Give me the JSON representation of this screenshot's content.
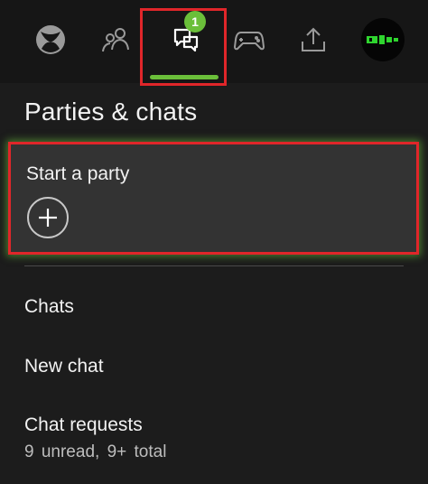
{
  "colors": {
    "accent": "#6bbf3a",
    "badge": "#6bbf3a",
    "highlight": "#e0262a",
    "icon": "#9a9a9a"
  },
  "nav": {
    "items": [
      {
        "icon": "xbox-logo-icon"
      },
      {
        "icon": "friends-icon"
      },
      {
        "icon": "parties-chats-icon",
        "active": true
      },
      {
        "icon": "controller-icon"
      },
      {
        "icon": "share-icon"
      },
      {
        "icon": "profile-avatar"
      }
    ],
    "parties_badge": "1"
  },
  "main": {
    "title": "Parties & chats",
    "start_party": {
      "label": "Start a party",
      "button_icon": "plus-icon"
    },
    "items": [
      {
        "label": "Chats"
      },
      {
        "label": "New chat"
      },
      {
        "label": "Chat requests",
        "subtitle": "9  unread, 9+ total"
      }
    ]
  }
}
